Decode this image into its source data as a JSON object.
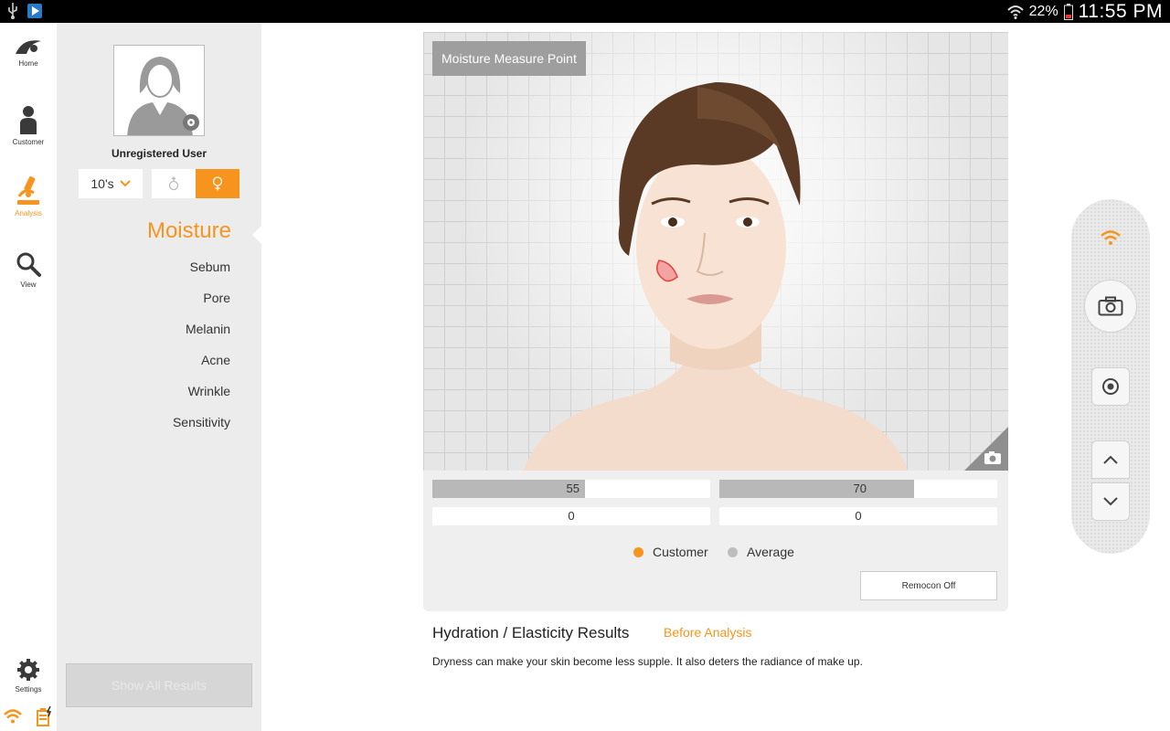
{
  "status_bar": {
    "battery_percent": "22%",
    "time": "11:55 PM",
    "icons": [
      "usb-icon",
      "play-store-icon",
      "wifi-icon",
      "battery-icon"
    ]
  },
  "nav": {
    "items": [
      {
        "label": "Home",
        "icon": "home-icon"
      },
      {
        "label": "Customer",
        "icon": "customer-icon"
      },
      {
        "label": "Analysis",
        "icon": "microscope-icon",
        "active": true
      },
      {
        "label": "View",
        "icon": "magnifier-icon"
      }
    ],
    "settings_label": "Settings"
  },
  "profile": {
    "username": "Unregistered User",
    "age_group": "10's",
    "gender_selected": "female"
  },
  "menu": {
    "active": "Moisture",
    "items": [
      "Sebum",
      "Pore",
      "Melanin",
      "Acne",
      "Wrinkle",
      "Sensitivity"
    ]
  },
  "show_all_results": "Show All Results",
  "measure": {
    "label": "Moisture Measure Point",
    "left_bar_value": "55",
    "left_bar_percent": 55,
    "right_bar_value": "70",
    "right_bar_percent": 70,
    "left_zero": "0",
    "right_zero": "0"
  },
  "legend": {
    "customer": "Customer",
    "average": "Average",
    "customer_color": "#f7941d",
    "average_color": "#bdbdbd"
  },
  "remocon_button": "Remocon Off",
  "results": {
    "title": "Hydration / Elasticity Results",
    "state": "Before Analysis",
    "description": "Dryness can make your skin become less supple. It also deters the radiance of make up."
  },
  "colors": {
    "accent": "#f7941d",
    "panel_bg": "#ececec"
  }
}
